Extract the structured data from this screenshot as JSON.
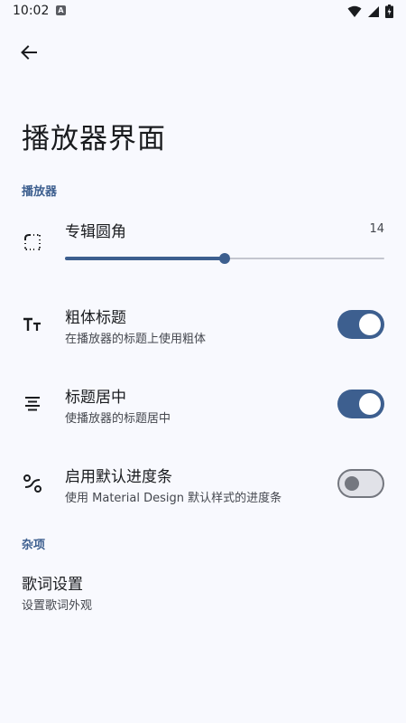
{
  "status_bar": {
    "time": "10:02",
    "app_badge": "A",
    "icons": [
      "wifi-icon",
      "signal-icon",
      "battery-charging-icon"
    ]
  },
  "header": {
    "back_icon": "arrow-back-icon",
    "title": "播放器界面"
  },
  "sections": {
    "player": {
      "label": "播放器",
      "slider": {
        "icon": "rounded-corner-icon",
        "title": "专辑圆角",
        "value": "14",
        "fill_fraction": 0.5
      },
      "toggles": [
        {
          "icon": "text-format-icon",
          "title": "粗体标题",
          "subtitle": "在播放器的标题上使用粗体",
          "on": true
        },
        {
          "icon": "align-center-icon",
          "title": "标题居中",
          "subtitle": "使播放器的标题居中",
          "on": true
        },
        {
          "icon": "progress-style-icon",
          "title": "启用默认进度条",
          "subtitle": "使用 Material Design 默认样式的进度条",
          "on": false
        }
      ]
    },
    "misc": {
      "label": "杂项",
      "items": [
        {
          "title": "歌词设置",
          "subtitle": "设置歌词外观"
        }
      ]
    }
  },
  "colors": {
    "background": "#F8F9FE",
    "accent": "#3D5F8F",
    "switch_off_track": "#E1E2E8",
    "switch_off_outline": "#74777F"
  }
}
